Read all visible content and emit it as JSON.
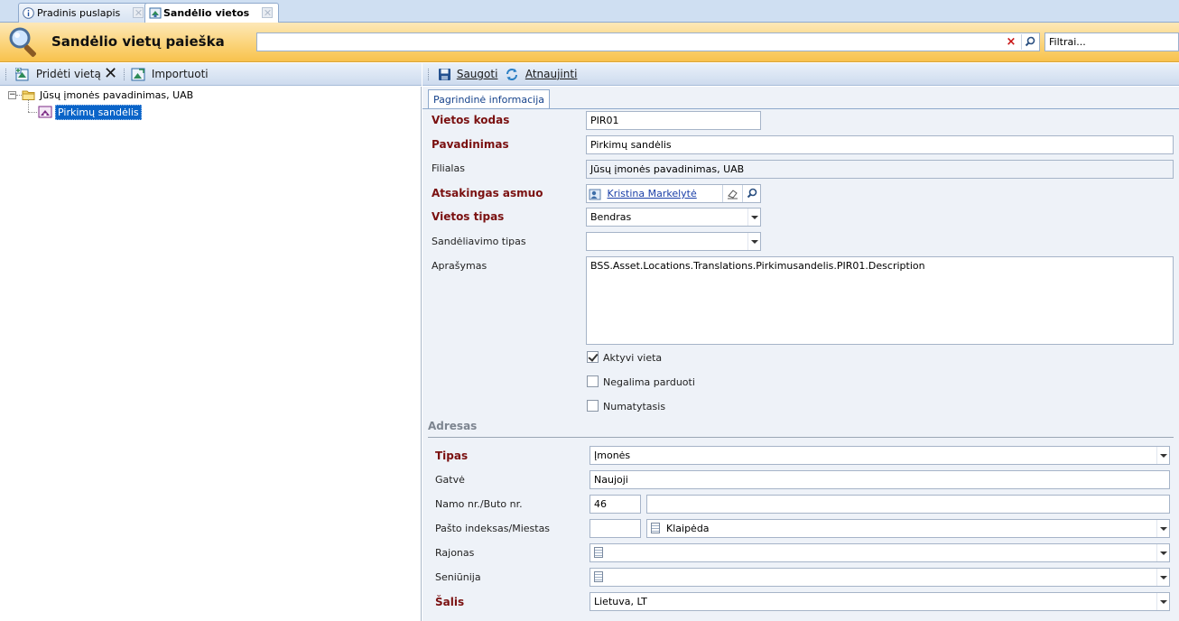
{
  "tabs": [
    {
      "label": "Pradinis puslapis",
      "icon": "info-icon"
    },
    {
      "label": "Sandėlio vietos",
      "icon": "warehouse-icon"
    }
  ],
  "header": {
    "title": "Sandėlio vietų paieška",
    "search_value": "",
    "filter_placeholder": "Filtrai..."
  },
  "left_toolbar": {
    "add_label": "Pridėti vietą",
    "import_label": "Importuoti"
  },
  "tree": {
    "root": "Jūsų įmonės pavadinimas, UAB",
    "children": [
      "Pirkimų sandėlis"
    ]
  },
  "right_toolbar": {
    "save_label": "Saugoti",
    "refresh_label": "Atnaujinti"
  },
  "form": {
    "tab": "Pagrindinė informacija",
    "location_code": {
      "label": "Vietos kodas",
      "value": "PIR01"
    },
    "name": {
      "label": "Pavadinimas",
      "value": "Pirkimų sandėlis"
    },
    "branch": {
      "label": "Filialas",
      "value": "Jūsų įmonės pavadinimas, UAB"
    },
    "responsible": {
      "label": "Atsakingas asmuo",
      "value": "Kristina Markelytė"
    },
    "location_type": {
      "label": "Vietos tipas",
      "value": "Bendras"
    },
    "storage_type": {
      "label": "Sandėliavimo tipas",
      "value": ""
    },
    "description": {
      "label": "Aprašymas",
      "value": "BSS.Asset.Locations.Translations.Pirkimusandelis.PIR01.Description"
    },
    "active": {
      "label": "Aktyvi vieta",
      "checked": true
    },
    "not_for_sale": {
      "label": "Negalima parduoti",
      "checked": false
    },
    "default": {
      "label": "Numatytasis",
      "checked": false
    }
  },
  "address": {
    "section": "Adresas",
    "type": {
      "label": "Tipas",
      "value": "Įmonės"
    },
    "street": {
      "label": "Gatvė",
      "value": "Naujoji"
    },
    "house": {
      "label": "Namo nr./Buto nr.",
      "house": "46",
      "apt": ""
    },
    "postal": {
      "label": "Pašto indeksas/Miestas",
      "code": "",
      "city": "Klaipėda"
    },
    "district": {
      "label": "Rajonas",
      "value": ""
    },
    "eldership": {
      "label": "Seniūnija",
      "value": ""
    },
    "country": {
      "label": "Šalis",
      "value": "Lietuva, LT"
    }
  },
  "colors": {
    "header": "#fbd47a",
    "required_label": "#7a1010",
    "selection": "#0a64c8"
  }
}
